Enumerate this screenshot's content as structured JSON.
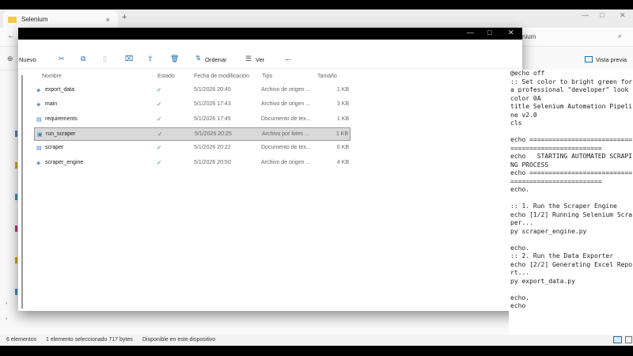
{
  "browser_tab": {
    "title": "Selenium",
    "close": "×",
    "new_tab": "+"
  },
  "bg_window": {
    "address_tail": "nium",
    "preview_label": "Vista previa",
    "controls": [
      "—",
      "□",
      "✕"
    ]
  },
  "front_window": {
    "controls": [
      "—",
      "□",
      "✕"
    ]
  },
  "toolbar": {
    "new_label": "Nuevo",
    "sort_label": "Ordenar",
    "view_label": "Ver",
    "more": "···"
  },
  "columns": [
    "Nombre",
    "Estado",
    "Fecha de modificación",
    "Tipo",
    "Tamaño"
  ],
  "files": [
    {
      "name": "export_data",
      "status": "✓",
      "date": "5/1/2026 20:45",
      "type": "Archivo de origen ...",
      "size": "1 KB",
      "icon": "python-file-icon"
    },
    {
      "name": "main",
      "status": "✓",
      "date": "5/1/2026 17:43",
      "type": "Archivo de origen ...",
      "size": "3 KB",
      "icon": "python-file-icon"
    },
    {
      "name": "requirements",
      "status": "✓",
      "date": "5/1/2026 17:45",
      "type": "Documento de tex...",
      "size": "1 KB",
      "icon": "text-file-icon"
    },
    {
      "name": "run_scraper",
      "status": "✓",
      "date": "5/1/2026 20:25",
      "type": "Archivo por lotes ...",
      "size": "1 KB",
      "icon": "batch-file-icon",
      "selected": true
    },
    {
      "name": "scraper",
      "status": "✓",
      "date": "5/1/2026 20:22",
      "type": "Documento de tex...",
      "size": "6 KB",
      "icon": "text-file-icon"
    },
    {
      "name": "scraper_engine",
      "status": "✓",
      "date": "5/1/2026 20:50",
      "type": "Archivo de origen ...",
      "size": "4 KB",
      "icon": "python-file-icon"
    }
  ],
  "code_preview": "@echo off\n:: Set color to bright green for a professional \"developer\" look\ncolor 0A\ntitle Selenium Automation Pipeline v2.0\ncls\n\necho ===================================================\necho   STARTING AUTOMATED SCRAPING PROCESS\necho ===================================================\necho.\n\n:: 1. Run the Scraper Engine\necho [1/2] Running Selenium Scraper...\npy scraper_engine.py\n\necho.\n:: 2. Run the Data Exporter\necho [2/2] Generating Excel Report...\npy export_data.py\n\necho.\necho",
  "status_bar": {
    "count": "6 elementos",
    "selection": "1 elemento seleccionado  717 bytes",
    "availability": "Disponible en este dispositivo"
  }
}
